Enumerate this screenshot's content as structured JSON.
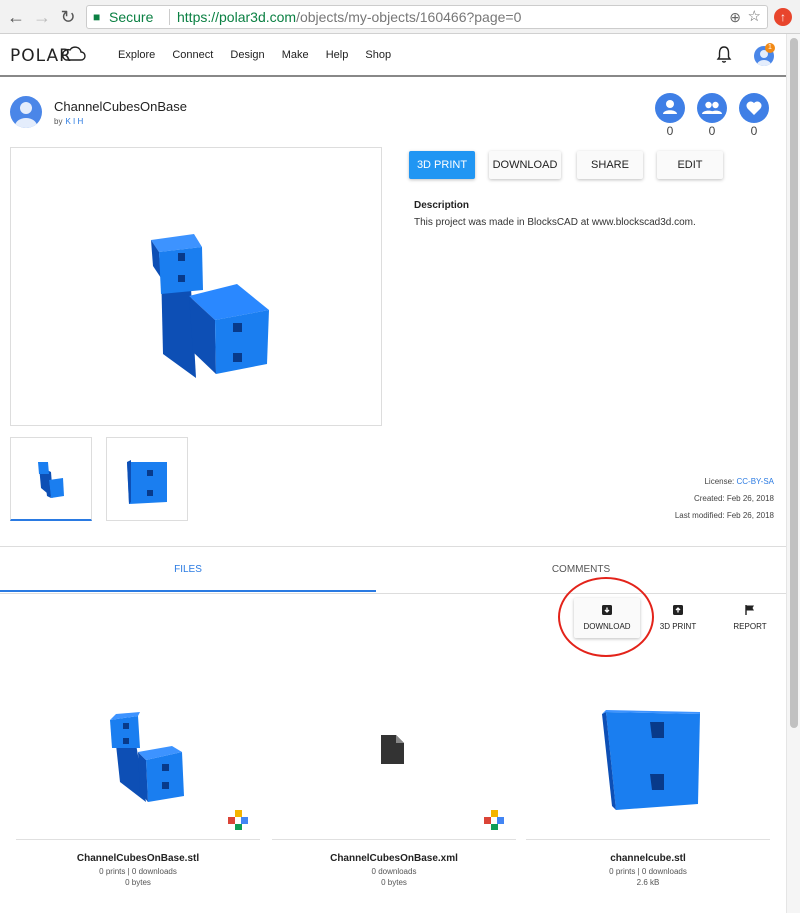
{
  "browser": {
    "secure_label": "Secure",
    "url_host": "https://polar3d.com",
    "url_path": "/objects/my-objects/160466?page=0"
  },
  "site": {
    "logo": "POLAR",
    "menu": [
      "Explore",
      "Connect",
      "Design",
      "Make",
      "Help",
      "Shop"
    ],
    "notification_count": "1"
  },
  "object": {
    "title": "ChannelCubesOnBase",
    "by_label": "by",
    "author": "K I H",
    "stats": {
      "followers": "0",
      "groups": "0",
      "likes": "0"
    }
  },
  "actions": {
    "print": "3D PRINT",
    "download": "DOWNLOAD",
    "share": "SHARE",
    "edit": "EDIT"
  },
  "description": {
    "heading": "Description",
    "text": "This project was made in BlocksCAD at www.blockscad3d.com."
  },
  "meta": {
    "license_label": "License:",
    "license": "CC-BY-SA",
    "created": "Created: Feb 26, 2018",
    "modified": "Last modified: Feb 26, 2018"
  },
  "tabs": {
    "files": "FILES",
    "comments": "COMMENTS"
  },
  "file_actions": {
    "download": "DOWNLOAD",
    "print": "3D PRINT",
    "report": "REPORT"
  },
  "files": [
    {
      "name": "ChannelCubesOnBase.stl",
      "stats": "0 prints | 0 downloads",
      "size": "0 bytes"
    },
    {
      "name": "ChannelCubesOnBase.xml",
      "stats": "0 downloads",
      "size": "0 bytes"
    },
    {
      "name": "channelcube.stl",
      "stats": "0 prints | 0 downloads",
      "size": "2.6 kB"
    }
  ],
  "colors": {
    "accent": "#2196f3",
    "link": "#2a7ae2",
    "highlight": "#e3231a",
    "cube_light": "#1a7ef0",
    "cube_dark": "#0d4fb5"
  }
}
